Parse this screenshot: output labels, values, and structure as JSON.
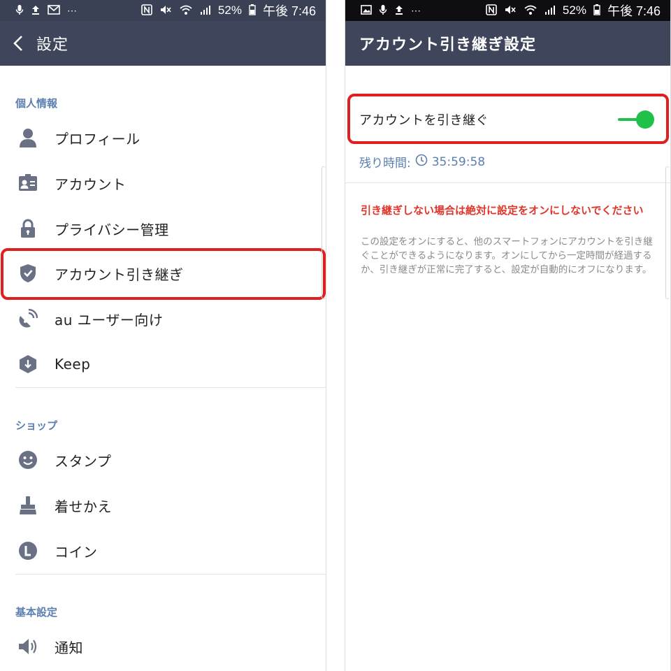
{
  "left": {
    "status": {
      "battery": "52%",
      "time": "午後 7:46"
    },
    "nav": {
      "title": "設定"
    },
    "sections": [
      {
        "header": "個人情報",
        "items": [
          {
            "label": "プロフィール",
            "icon": "person-icon"
          },
          {
            "label": "アカウント",
            "icon": "id-card-icon"
          },
          {
            "label": "プライバシー管理",
            "icon": "lock-icon"
          },
          {
            "label": "アカウント引き継ぎ",
            "icon": "shield-check-icon"
          },
          {
            "label": "au ユーザー向け",
            "icon": "satellite-dish-icon"
          },
          {
            "label": "Keep",
            "icon": "keep-hexagon-icon"
          }
        ]
      },
      {
        "header": "ショップ",
        "items": [
          {
            "label": "スタンプ",
            "icon": "smiley-icon"
          },
          {
            "label": "着せかえ",
            "icon": "brush-icon"
          },
          {
            "label": "コイン",
            "icon": "coin-icon"
          }
        ]
      },
      {
        "header": "基本設定",
        "items": [
          {
            "label": "通知",
            "icon": "speaker-icon"
          }
        ]
      }
    ]
  },
  "right": {
    "status": {
      "battery": "52%",
      "time": "午後 7:46"
    },
    "nav": {
      "title": "アカウント引き継ぎ設定"
    },
    "toggle": {
      "label": "アカウントを引き継ぐ",
      "state": "on",
      "color": "#1fc14a"
    },
    "remaining": {
      "label": "残り時間:",
      "value": "35:59:58"
    },
    "warning": "引き継ぎしない場合は絶対に設定をオンにしないでください",
    "note": "この設定をオンにすると、他のスマートフォンにアカウントを引き継ぐことができるようになります。オンにしてから一定時間が経過するか、引き継ぎが正常に完了すると、設定が自動的にオフになります。"
  },
  "colors": {
    "header_bg": "#3f465b",
    "accent_blue": "#5a7fb0",
    "highlight_red": "#e02020",
    "warning_red": "#e0352b",
    "icon_gray": "#6b7184"
  }
}
